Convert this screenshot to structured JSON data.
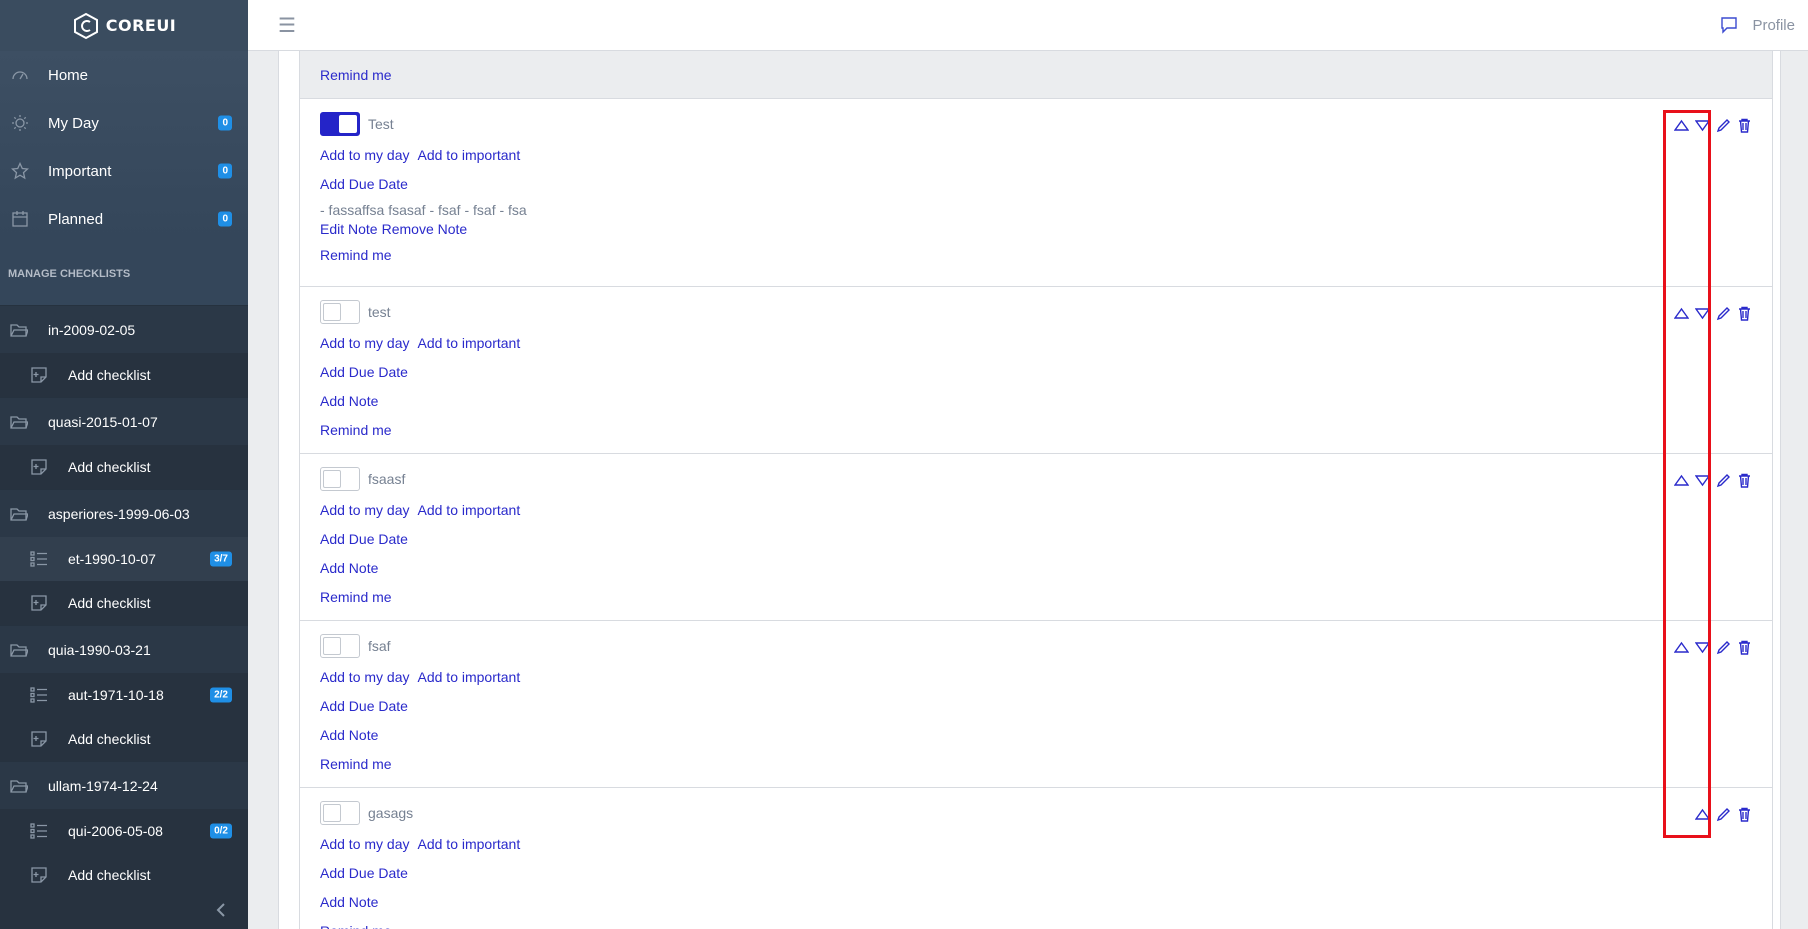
{
  "brand": {
    "name": "COREUI"
  },
  "nav": {
    "items": [
      {
        "label": "Home",
        "icon": "speedometer-icon",
        "badge": ""
      },
      {
        "label": "My Day",
        "icon": "sun-icon",
        "badge": "0"
      },
      {
        "label": "Important",
        "icon": "star-icon",
        "badge": "0"
      },
      {
        "label": "Planned",
        "icon": "calendar-icon",
        "badge": "0"
      }
    ],
    "section_title": "MANAGE CHECKLISTS",
    "groups": [
      {
        "label": "in-2009-02-05",
        "children": [
          {
            "label": "Add checklist",
            "badge": ""
          }
        ]
      },
      {
        "label": "quasi-2015-01-07",
        "children": [
          {
            "label": "Add checklist",
            "badge": ""
          }
        ]
      },
      {
        "label": "asperiores-1999-06-03",
        "children": [
          {
            "label": "et-1990-10-07",
            "badge": "3/7"
          },
          {
            "label": "Add checklist",
            "badge": ""
          }
        ]
      },
      {
        "label": "quia-1990-03-21",
        "children": [
          {
            "label": "aut-1971-10-18",
            "badge": "2/2"
          },
          {
            "label": "Add checklist",
            "badge": ""
          }
        ]
      },
      {
        "label": "ullam-1974-12-24",
        "children": [
          {
            "label": "qui-2006-05-08",
            "badge": "0/2"
          },
          {
            "label": "Add checklist",
            "badge": ""
          }
        ]
      }
    ]
  },
  "header": {
    "profile_label": "Profile"
  },
  "tasks": {
    "top_remind": "Remind me",
    "labels": {
      "add_my_day": "Add to my day",
      "add_important": "Add to important",
      "add_due": "Add Due Date",
      "add_note": "Add Note",
      "edit_note": "Edit Note",
      "remove_note": "Remove Note",
      "remind": "Remind me"
    },
    "items": [
      {
        "title": "Test",
        "done": true,
        "note": "- fassaffsa fsasaf - fsaf - fsaf - fsa"
      },
      {
        "title": "test",
        "done": false,
        "note": ""
      },
      {
        "title": "fsaasf",
        "done": false,
        "note": ""
      },
      {
        "title": "fsaf",
        "done": false,
        "note": ""
      },
      {
        "title": "gasags",
        "done": false,
        "note": ""
      }
    ]
  },
  "colors": {
    "accent": "#2a2acb",
    "highlight": "#e8101a",
    "sidebar": "#2f3d4d",
    "badge": "#1f8fe6"
  }
}
